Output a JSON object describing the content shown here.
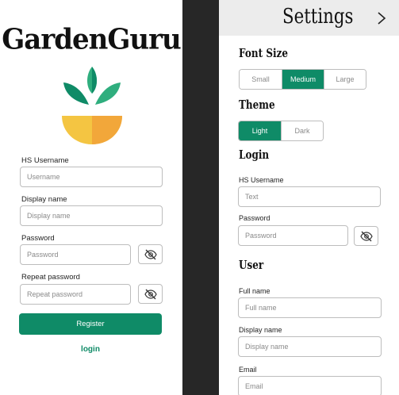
{
  "colors": {
    "primary": "#0f8b67",
    "separator": "#272727",
    "header_bg": "#ececec",
    "leaf_dark": "#0f8b67",
    "leaf_light": "#2fae7e",
    "pot_yellow": "#f4c542",
    "pot_orange": "#f2a73a"
  },
  "register": {
    "app_name": "GardenGuru",
    "fields": {
      "username_label": "HS Username",
      "username_placeholder": "Username",
      "display_label": "Display name",
      "display_placeholder": "Display name",
      "password_label": "Password",
      "password_placeholder": "Password",
      "repeat_label": "Repeat password",
      "repeat_placeholder": "Repeat password"
    },
    "register_button": "Register",
    "login_link": "login"
  },
  "settings": {
    "title": "Settings",
    "font_size": {
      "heading": "Font Size",
      "options": [
        "Small",
        "Medium",
        "Large"
      ],
      "selected": "Medium"
    },
    "theme": {
      "heading": "Theme",
      "options": [
        "Light",
        "Dark"
      ],
      "selected": "Light"
    },
    "login": {
      "heading": "Login",
      "username_label": "HS Username",
      "username_placeholder": "Text",
      "password_label": "Password",
      "password_placeholder": "Password"
    },
    "user": {
      "heading": "User",
      "fullname_label": "Full name",
      "fullname_placeholder": "Full name",
      "display_label": "Display name",
      "display_placeholder": "Display name",
      "email_label": "Email",
      "email_placeholder": "Email"
    }
  },
  "icons": {
    "eye_toggle": "eye-off-icon",
    "back": "chevron-right-icon",
    "logo": "plant-pot-icon"
  }
}
